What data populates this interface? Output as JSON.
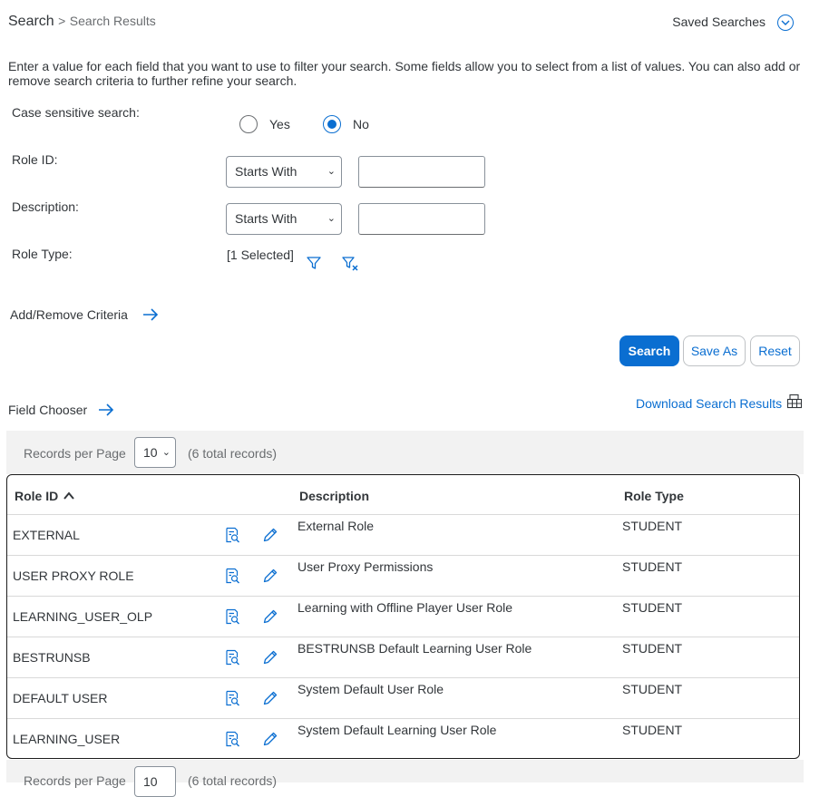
{
  "breadcrumb": {
    "current": "Search",
    "separator": ">",
    "page": "Search Results"
  },
  "saved_searches": {
    "label": "Saved Searches"
  },
  "intro_text": "Enter a value for each field that you want to use to filter your search. Some fields allow you to select from a list of values. You can also add or remove search criteria to further refine your search.",
  "form": {
    "case_sensitive": {
      "label": "Case sensitive search:",
      "yes": "Yes",
      "no": "No",
      "selected": "No"
    },
    "role_id": {
      "label": "Role ID:",
      "operator": "Starts With",
      "value": ""
    },
    "description": {
      "label": "Description:",
      "operator": "Starts With",
      "value": ""
    },
    "role_type": {
      "label": "Role Type:",
      "value": "[1 Selected]"
    }
  },
  "add_remove_criteria": "Add/Remove Criteria",
  "buttons": {
    "search": "Search",
    "save_as": "Save As",
    "reset": "Reset"
  },
  "field_chooser": "Field Chooser",
  "download_results": "Download Search Results",
  "pagination": {
    "records_label": "Records per Page",
    "per_page": "10",
    "total": "(6 total records)"
  },
  "table": {
    "columns": {
      "role_id": "Role ID",
      "description": "Description",
      "role_type": "Role Type"
    },
    "sort_indicator": "^",
    "rows": [
      {
        "role_id": "EXTERNAL",
        "description": "External Role",
        "role_type": "STUDENT"
      },
      {
        "role_id": "USER PROXY ROLE",
        "description": "User Proxy Permissions",
        "role_type": "STUDENT"
      },
      {
        "role_id": "LEARNING_USER_OLP",
        "description": "Learning with Offline Player User Role",
        "role_type": "STUDENT"
      },
      {
        "role_id": "BESTRUNSB",
        "description": "BESTRUNSB Default Learning User Role",
        "role_type": "STUDENT"
      },
      {
        "role_id": "DEFAULT USER",
        "description": "System Default User Role",
        "role_type": "STUDENT"
      },
      {
        "role_id": "LEARNING_USER",
        "description": "System Default Learning User Role",
        "role_type": "STUDENT"
      }
    ]
  },
  "colors": {
    "accent": "#0a6ed1",
    "text": "#32363a",
    "muted": "#6a6d70",
    "bar": "#f2f2f2"
  },
  "icons": [
    "chevron-down-icon",
    "filter-icon",
    "clear-filter-icon",
    "arrow-right-icon",
    "spreadsheet-icon",
    "view-details-icon",
    "edit-icon"
  ]
}
